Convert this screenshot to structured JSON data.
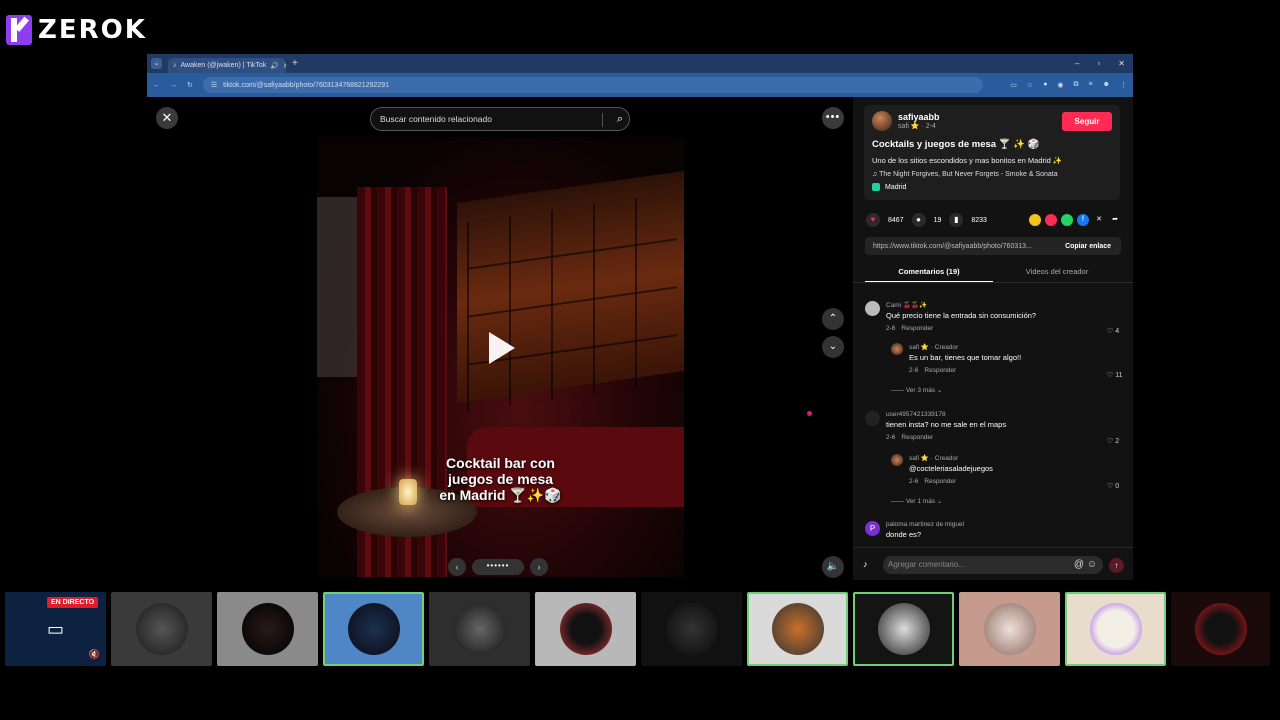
{
  "logo": {
    "text": "ZEROK"
  },
  "browser": {
    "tab_title": "Awaken (@jwaken) | TikTok",
    "new_tab": "+",
    "url": "tiktok.com/@safiyaabb/photo/7603134768821292291",
    "window_controls": [
      "–",
      "▫",
      "✕"
    ]
  },
  "viewer": {
    "search_placeholder": "Buscar contenido relacionado",
    "caption_lines": [
      "Cocktail bar con",
      "juegos de mesa",
      "en Madrid 🍸✨🎲"
    ],
    "dots": "••••••"
  },
  "post": {
    "username": "safiyaabb",
    "handle_line": "safi ⭐ · 2-4",
    "follow_label": "Seguir",
    "title": "Cocktails y juegos de mesa 🍸 ✨ 🎲",
    "description": "Uno de los sitios escondidos y mas bonitos en Madrid ✨",
    "music": "♫  The Night Forgives, But Never Forgets - Smoke & Sonata",
    "location": "Madrid",
    "likes": "8467",
    "comments_count": "19",
    "saves": "8233",
    "link": "https://www.tiktok.com/@safiyaabb/photo/760313...",
    "copy_label": "Copiar enlace",
    "tab_comments": "Comentarios (19)",
    "tab_videos": "Videos del creador"
  },
  "comments": [
    {
      "name": "Cami 🍒🍒✨",
      "text": "Qué precio tiene la entrada sin consumición?",
      "date": "2-6",
      "reply": "Responder",
      "likes": "4"
    },
    {
      "name": "safi ⭐ · Creador",
      "text": "Es un bar, tienes que tomar algo!!",
      "date": "2-6",
      "reply": "Responder",
      "likes": "11"
    },
    {
      "more": "Ver 3 más"
    },
    {
      "name": "user4957421339178",
      "text": "tienen insta? no me sale en el maps",
      "date": "2-6",
      "reply": "Responder",
      "likes": "2"
    },
    {
      "name": "safi ⭐ · Creador",
      "text": "@cocteleriasaladejuegos",
      "date": "2-6",
      "reply": "Responder",
      "likes": "0"
    },
    {
      "more": "Ver 1 más"
    },
    {
      "name": "paloma martinez de miguel",
      "text": "donde es?"
    }
  ],
  "composer": {
    "placeholder": "Agregar comentario..."
  },
  "strip": {
    "live_label": "EN DIRECTO"
  },
  "colors": {
    "accent": "#fe2c55",
    "logo": "#8f3df0",
    "creator": "#2fbfe8",
    "selected_border": "#6fd07a"
  }
}
